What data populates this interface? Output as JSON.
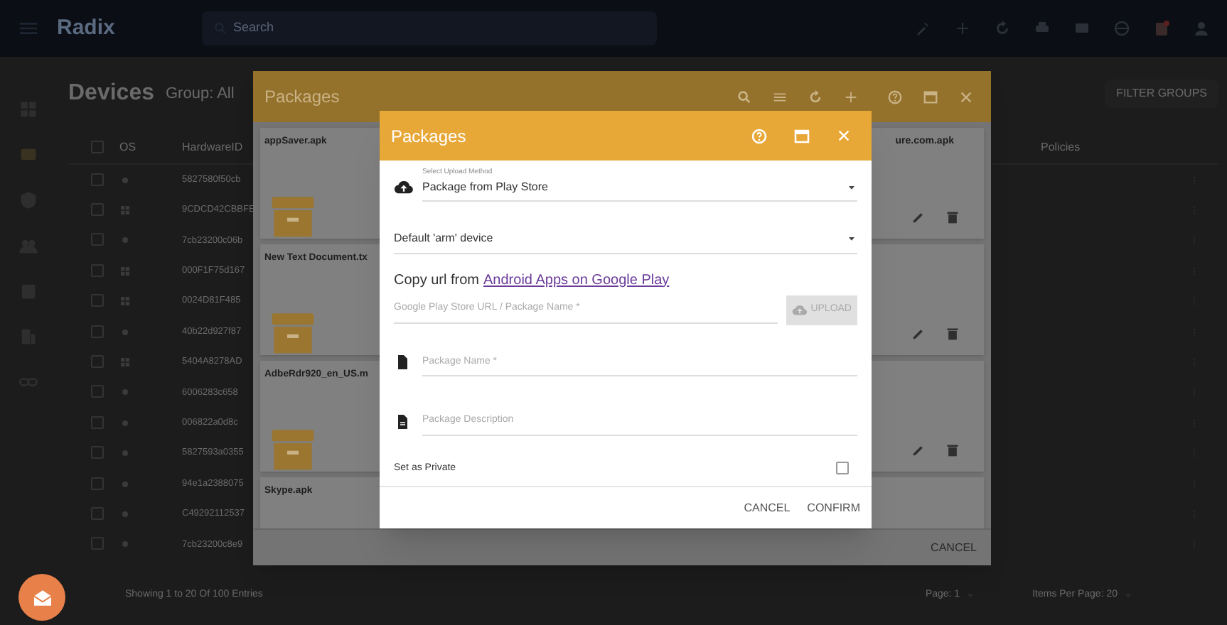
{
  "app_bar": {
    "brand": "Radix",
    "search": {
      "placeholder": "Search"
    }
  },
  "page": {
    "title": "Devices",
    "group": "Group: All",
    "filter_button": "FILTER GROUPS",
    "columns": [
      "OS",
      "HardwareID",
      "Policies"
    ],
    "header_checkbox": {
      "checked": false
    },
    "rows": [
      {
        "kind": "android",
        "hardware_id": "5827580f50cb",
        "checked": false
      },
      {
        "kind": "windows",
        "hardware_id": "9CDCD42CBBFE",
        "checked": false
      },
      {
        "kind": "android",
        "hardware_id": "7cb23200c06b",
        "checked": false
      },
      {
        "kind": "windows",
        "hardware_id": "000F1F75d167",
        "checked": false
      },
      {
        "kind": "windows",
        "hardware_id": "0024D81F485",
        "checked": false
      },
      {
        "kind": "android",
        "hardware_id": "40b22d927f87",
        "checked": false
      },
      {
        "kind": "windows",
        "hardware_id": "5404A8278AD",
        "checked": false
      },
      {
        "kind": "android",
        "hardware_id": "6006283c658",
        "checked": false
      },
      {
        "kind": "android",
        "hardware_id": "006822a0d8c",
        "checked": false
      },
      {
        "kind": "android",
        "hardware_id": "5827593a0355",
        "checked": false
      },
      {
        "kind": "android",
        "hardware_id": "94e1a2388075",
        "checked": false
      },
      {
        "kind": "android",
        "hardware_id": "C49292112537",
        "checked": false
      },
      {
        "kind": "android",
        "hardware_id": "7cb23200c8e9",
        "checked": false
      }
    ],
    "footer": "Showing 1 to 20 Of 100 Entries",
    "page_select": "Page: 1",
    "items_per_page": "Items Per Page: 20"
  },
  "packages_panel": {
    "title": "Packages",
    "cards_left": [
      {
        "name": "appSaver.apk",
        "archive": true
      },
      {
        "name": "New Text Document.tx",
        "archive": true
      },
      {
        "name": "AdbeRdr920_en_US.m",
        "archive": true
      },
      {
        "name": "Skype.apk"
      }
    ],
    "cards_right": [
      {
        "name": "ure.com.apk",
        "actions": true
      },
      {
        "actions": true
      },
      {
        "actions": true
      }
    ],
    "cancel": "CANCEL"
  },
  "dialog": {
    "title": "Packages",
    "upload_method": {
      "label": "Select Upload Method",
      "value": "Package from Play Store"
    },
    "device_select": {
      "value": "Default 'arm' device"
    },
    "copy_text": "Copy url from",
    "copy_link": "Android Apps on Google Play",
    "url_field": {
      "placeholder": "Google Play Store URL / Package Name *"
    },
    "upload_button": {
      "label": "UPLOAD",
      "disabled": true
    },
    "name_field": {
      "placeholder": "Package Name *"
    },
    "description_field": {
      "placeholder": "Package Description"
    },
    "private": {
      "label": "Set as Private",
      "checked": false
    },
    "buttons": [
      "CANCEL",
      "CONFIRM"
    ]
  }
}
